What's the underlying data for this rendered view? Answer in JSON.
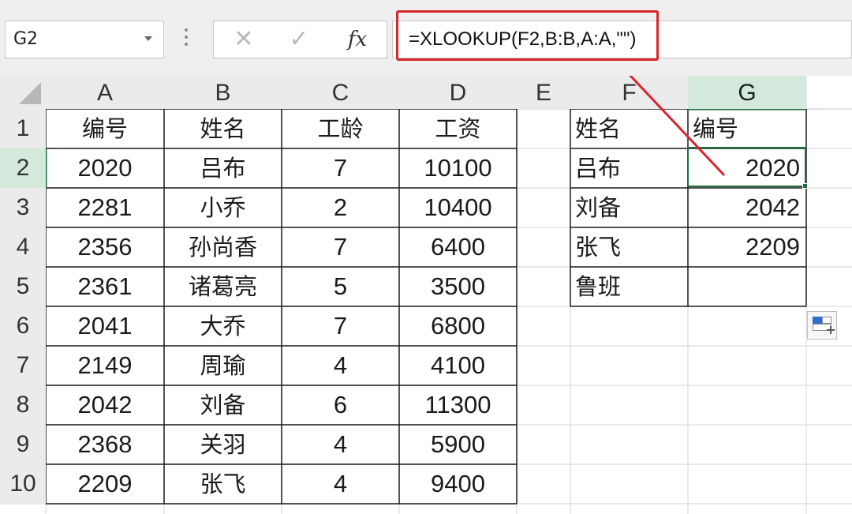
{
  "formula_bar": {
    "name_box": "G2",
    "cancel_symbol": "✕",
    "enter_symbol": "✓",
    "fx_label": "fx",
    "formula": "=XLOOKUP(F2,B:B,A:A,\"\")"
  },
  "grid": {
    "columns": [
      "A",
      "B",
      "C",
      "D",
      "E",
      "F",
      "G"
    ],
    "rows": [
      "1",
      "2",
      "3",
      "4",
      "5",
      "6",
      "7",
      "8",
      "9",
      "10"
    ],
    "selected_cell": "G2",
    "main_table": {
      "headers": [
        "编号",
        "姓名",
        "工龄",
        "工资"
      ],
      "rows": [
        [
          "2020",
          "吕布",
          "7",
          "10100"
        ],
        [
          "2281",
          "小乔",
          "2",
          "10400"
        ],
        [
          "2356",
          "孙尚香",
          "7",
          "6400"
        ],
        [
          "2361",
          "诸葛亮",
          "5",
          "3500"
        ],
        [
          "2041",
          "大乔",
          "7",
          "6800"
        ],
        [
          "2149",
          "周瑜",
          "4",
          "4100"
        ],
        [
          "2042",
          "刘备",
          "6",
          "11300"
        ],
        [
          "2368",
          "关羽",
          "4",
          "5900"
        ],
        [
          "2209",
          "张飞",
          "4",
          "9400"
        ]
      ]
    },
    "lookup_table": {
      "headers": [
        "姓名",
        "编号"
      ],
      "rows": [
        [
          "吕布",
          "2020"
        ],
        [
          "刘备",
          "2042"
        ],
        [
          "张飞",
          "2209"
        ],
        [
          "鲁班",
          ""
        ]
      ]
    }
  },
  "colors": {
    "highlight_red": "#d9262e",
    "selection_green": "#1e6e42",
    "selected_header": "#d3e9dc"
  }
}
